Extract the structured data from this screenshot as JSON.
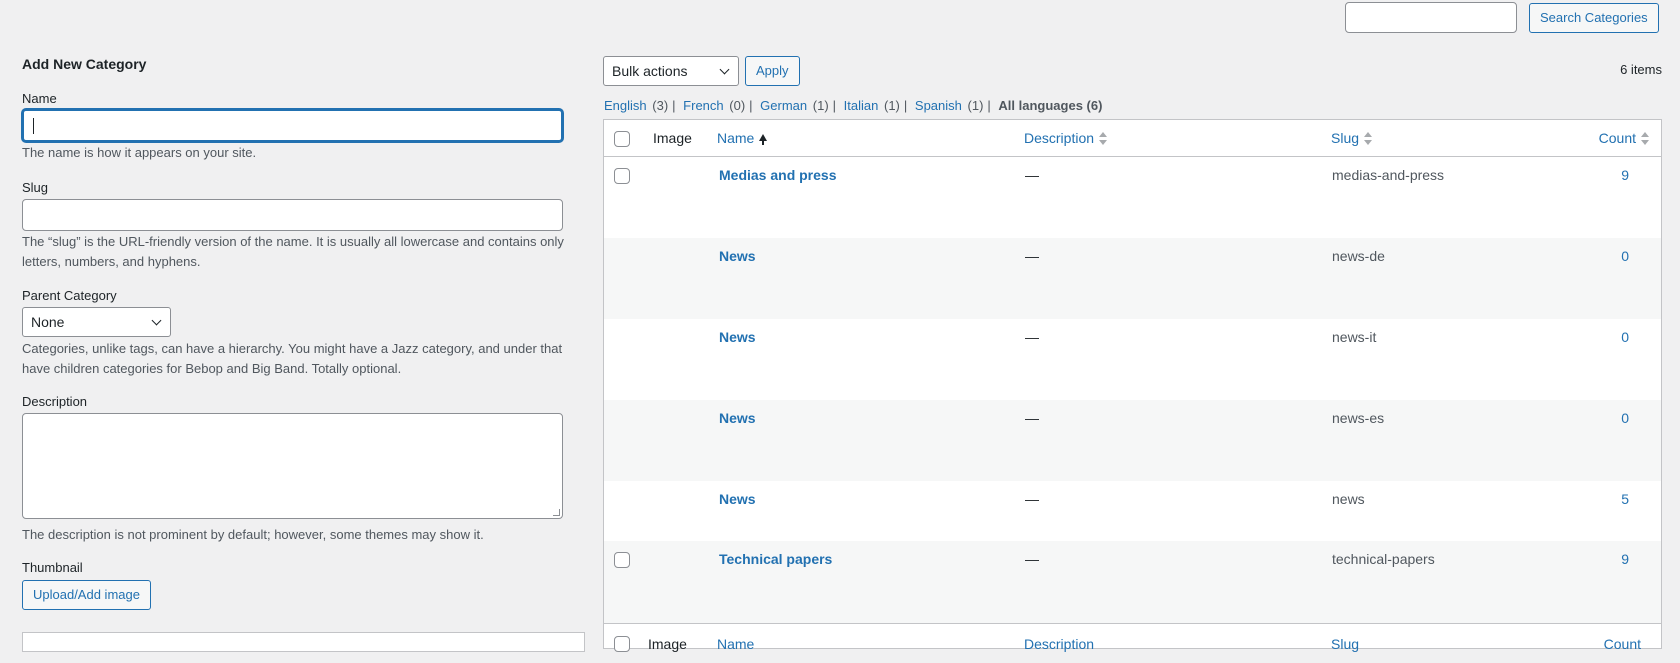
{
  "search": {
    "value": "",
    "button_label": "Search Categories"
  },
  "form": {
    "title": "Add New Category",
    "name": {
      "label": "Name",
      "value": "",
      "hint": "The name is how it appears on your site."
    },
    "slug": {
      "label": "Slug",
      "value": "",
      "hint": "The “slug” is the URL-friendly version of the name. It is usually all lowercase and contains only letters, numbers, and hyphens."
    },
    "parent": {
      "label": "Parent Category",
      "selected": "None",
      "hint": "Categories, unlike tags, can have a hierarchy. You might have a Jazz category, and under that have children categories for Bebop and Big Band. Totally optional."
    },
    "description": {
      "label": "Description",
      "value": "",
      "hint": "The description is not prominent by default; however, some themes may show it."
    },
    "thumbnail": {
      "label": "Thumbnail",
      "button_label": "Upload/Add image"
    }
  },
  "toolbar": {
    "bulk_actions": "Bulk actions",
    "apply_label": "Apply",
    "items_count": "6 items"
  },
  "languages": [
    {
      "name": "English",
      "count": "(3)"
    },
    {
      "name": "French",
      "count": "(0)"
    },
    {
      "name": "German",
      "count": "(1)"
    },
    {
      "name": "Italian",
      "count": "(1)"
    },
    {
      "name": "Spanish",
      "count": "(1)"
    }
  ],
  "languages_all": "All languages (6)",
  "table": {
    "columns": {
      "image": "Image",
      "name": "Name",
      "description": "Description",
      "slug": "Slug",
      "count": "Count"
    },
    "rows": [
      {
        "name": "Medias and press",
        "description": "—",
        "slug": "medias-and-press",
        "count": "9",
        "checkbox": true
      },
      {
        "name": "News",
        "description": "—",
        "slug": "news-de",
        "count": "0",
        "checkbox": false
      },
      {
        "name": "News",
        "description": "—",
        "slug": "news-it",
        "count": "0",
        "checkbox": false
      },
      {
        "name": "News",
        "description": "—",
        "slug": "news-es",
        "count": "0",
        "checkbox": false
      },
      {
        "name": "News",
        "description": "—",
        "slug": "news",
        "count": "5",
        "checkbox": false
      },
      {
        "name": "Technical papers",
        "description": "—",
        "slug": "technical-papers",
        "count": "9",
        "checkbox": true
      }
    ]
  },
  "colors": {
    "accent": "#2271b1",
    "background": "#f0f0f1",
    "row_alt": "#f6f7f7"
  }
}
